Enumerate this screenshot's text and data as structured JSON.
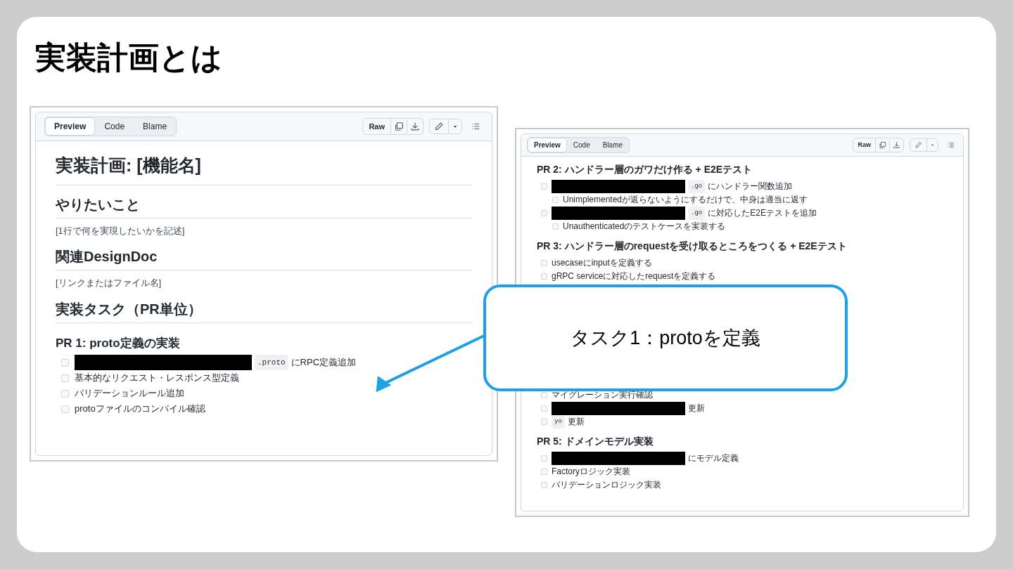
{
  "slide_title": "実装計画とは",
  "panels": [
    {
      "tabs": [
        {
          "label": "Preview",
          "selected": true
        },
        {
          "label": "Code",
          "selected": false
        },
        {
          "label": "Blame",
          "selected": false
        }
      ],
      "raw_button": "Raw",
      "blocks": [
        {
          "kind": "h1",
          "text": "実装計画: [機能名]"
        },
        {
          "kind": "h2",
          "text": "やりたいこと"
        },
        {
          "kind": "p",
          "text": "[1行で何を実現したいかを記述]"
        },
        {
          "kind": "h2",
          "text": "関連DesignDoc"
        },
        {
          "kind": "p",
          "text": "[リンクまたはファイル名]"
        },
        {
          "kind": "h2",
          "text": "実装タスク（PR単位）"
        },
        {
          "kind": "h3",
          "text": "PR 1: proto定義の実装"
        },
        {
          "kind": "task",
          "checked": false,
          "parts": [
            {
              "kind": "redacted"
            },
            {
              "kind": "code",
              "text": ".proto"
            },
            {
              "kind": "text",
              "text": "にRPC定義追加"
            }
          ]
        },
        {
          "kind": "task",
          "checked": false,
          "parts": [
            {
              "kind": "text",
              "text": "基本的なリクエスト・レスポンス型定義"
            }
          ]
        },
        {
          "kind": "task",
          "checked": false,
          "parts": [
            {
              "kind": "text",
              "text": "バリデーションルール追加"
            }
          ]
        },
        {
          "kind": "task",
          "checked": false,
          "parts": [
            {
              "kind": "text",
              "text": "protoファイルのコンパイル確認"
            }
          ]
        }
      ]
    },
    {
      "tabs": [
        {
          "label": "Preview",
          "selected": true
        },
        {
          "label": "Code",
          "selected": false
        },
        {
          "label": "Blame",
          "selected": false
        }
      ],
      "raw_button": "Raw",
      "blocks": [
        {
          "kind": "h3",
          "text": "PR 2: ハンドラー層のガワだけ作る + E2Eテスト"
        },
        {
          "kind": "task",
          "checked": false,
          "parts": [
            {
              "kind": "redacted"
            },
            {
              "kind": "code",
              "text": ".go"
            },
            {
              "kind": "text",
              "text": "にハンドラー関数追加"
            }
          ],
          "children": [
            {
              "kind": "task",
              "checked": false,
              "parts": [
                {
                  "kind": "text",
                  "text": "Unimplementedが返らないようにするだけで、中身は適当に返す"
                }
              ]
            }
          ]
        },
        {
          "kind": "task",
          "checked": false,
          "parts": [
            {
              "kind": "redacted"
            },
            {
              "kind": "code",
              "text": ".go"
            },
            {
              "kind": "text",
              "text": "に対応したE2Eテストを追加"
            }
          ],
          "children": [
            {
              "kind": "task",
              "checked": false,
              "parts": [
                {
                  "kind": "text",
                  "text": "Unauthenticatedのテストケースを実装する"
                }
              ]
            }
          ]
        },
        {
          "kind": "h3",
          "text": "PR 3: ハンドラー層のrequestを受け取るところをつくる + E2Eテスト"
        },
        {
          "kind": "task",
          "checked": false,
          "parts": [
            {
              "kind": "text",
              "text": "usecaseにinputを定義する"
            }
          ]
        },
        {
          "kind": "task",
          "checked": false,
          "parts": [
            {
              "kind": "text",
              "text": "gRPC serviceに対応したrequestを定義する"
            }
          ]
        },
        {
          "kind": "covered"
        },
        {
          "kind": "task",
          "checked": false,
          "parts": [
            {
              "kind": "text",
              "text": "マイグレーション実行確認"
            }
          ]
        },
        {
          "kind": "task",
          "checked": false,
          "parts": [
            {
              "kind": "redacted"
            },
            {
              "kind": "text",
              "text": "更新"
            }
          ]
        },
        {
          "kind": "task",
          "checked": false,
          "parts": [
            {
              "kind": "code",
              "text": "yo"
            },
            {
              "kind": "text",
              "text": "更新"
            }
          ]
        },
        {
          "kind": "h3",
          "text": "PR 5: ドメインモデル実装"
        },
        {
          "kind": "task",
          "checked": false,
          "parts": [
            {
              "kind": "redacted"
            },
            {
              "kind": "text",
              "text": "にモデル定義"
            }
          ]
        },
        {
          "kind": "task",
          "checked": false,
          "parts": [
            {
              "kind": "text",
              "text": "Factoryロジック実装"
            }
          ]
        },
        {
          "kind": "task",
          "checked": false,
          "parts": [
            {
              "kind": "text",
              "text": "バリデーションロジック実装"
            }
          ]
        }
      ]
    }
  ],
  "callout": {
    "text": "タスク1：protoを定義"
  }
}
